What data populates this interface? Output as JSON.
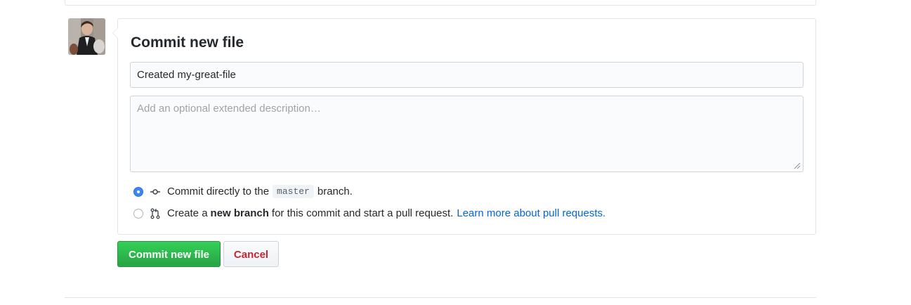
{
  "commit_form": {
    "title": "Commit new file",
    "summary_value": "Created my-great-file",
    "description_placeholder": "Add an optional extended description…",
    "options": [
      {
        "selected": true,
        "prefix": "Commit directly to the",
        "branch": "master",
        "suffix": "branch."
      },
      {
        "selected": false,
        "prefix": "Create a",
        "bold": "new branch",
        "suffix": "for this commit and start a pull request.",
        "link": "Learn more about pull requests."
      }
    ],
    "primary_button": "Commit new file",
    "cancel_button": "Cancel"
  },
  "icons": {
    "option_1": "git-commit-icon",
    "option_2": "git-pull-request-icon",
    "textarea_resize": "resize-handle-icon"
  },
  "colors": {
    "primary": "#28a745",
    "danger": "#cb2431",
    "link": "#0366d6",
    "radio_selected": "#3b86f7"
  }
}
